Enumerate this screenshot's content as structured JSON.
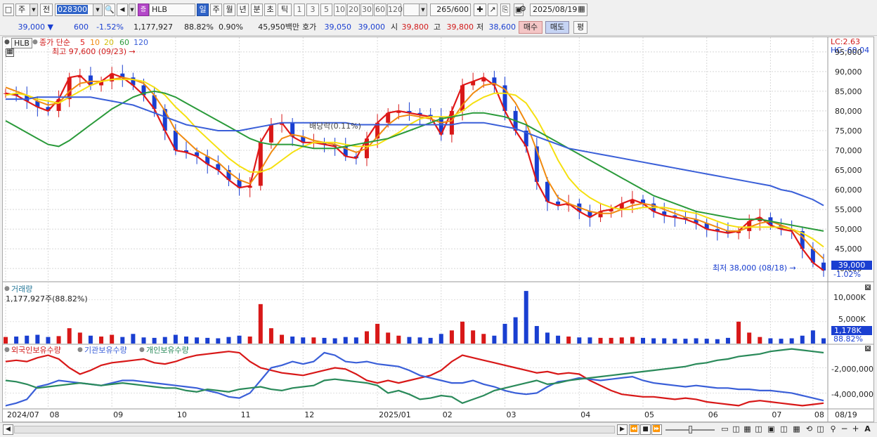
{
  "toolbar": {
    "period_main": "주",
    "prev_btn": "전",
    "code": "028300",
    "stock_name": "HLB",
    "periods": [
      "일",
      "주",
      "월",
      "년",
      "분",
      "초",
      "틱"
    ],
    "intervals": [
      "1",
      "3",
      "5",
      "10",
      "20",
      "30",
      "60",
      "120"
    ],
    "count": "265",
    "count_total": "/600",
    "date": "2025/08/19"
  },
  "quote": {
    "price": "39,000",
    "change": "600",
    "change_pct": "-1.52%",
    "volume": "1,177,927",
    "vol_ratio": "88.82%",
    "turnover": "0.90%",
    "amount": "45,950백만",
    "bid_label": "호가",
    "bid": "39,050",
    "ask": "39,000",
    "open_label": "시",
    "open": "39,800",
    "high_label": "고",
    "high": "39,800",
    "low_label": "저",
    "low": "38,600",
    "buy": "매수",
    "sell": "매도",
    "avg": "평"
  },
  "price_panel": {
    "tag": "HLB",
    "legend_title": "종가 단순",
    "ma_periods": [
      "5",
      "10",
      "20",
      "60",
      "120"
    ],
    "high_note": "최고 97,600 (09/23)",
    "low_note": "최저 38,000 (08/18)",
    "dividend_note": "배당락(0.11%)",
    "lc": "LC:2.63",
    "hc": "HC:-60.04",
    "y_ticks": [
      "95,000",
      "90,000",
      "85,000",
      "80,000",
      "75,000",
      "70,000",
      "65,000",
      "60,000",
      "55,000",
      "50,000",
      "45,000",
      "40,000"
    ],
    "cur_price": "39,000",
    "cur_pct": "-1.02%"
  },
  "volume_panel": {
    "title": "거래량",
    "value": "1,177,927주(88.82%)",
    "y_ticks": [
      "10,000K",
      "5,000K"
    ],
    "cur": "1,178K",
    "cur_pct": "88.82%"
  },
  "holding_panel": {
    "series": [
      "외국인보유수량",
      "기관보유수량",
      "개인보유수량"
    ],
    "y_ticks": [
      "-2,000,000",
      "-4,000,000"
    ]
  },
  "x_axis": [
    "2024/07",
    "08",
    "09",
    "10",
    "11",
    "12",
    "2025/01",
    "02",
    "03",
    "04",
    "05",
    "06",
    "07",
    "08"
  ],
  "x_axis_right": "08/19",
  "colors": {
    "ma5": "#e01818",
    "ma10": "#f08a10",
    "ma20": "#f5e010",
    "ma60": "#2a9a3a",
    "ma120": "#3a5fd8",
    "up": "#d81818",
    "down": "#1a3fd1",
    "foreign": "#d81818",
    "institution": "#3a5fd8",
    "individual": "#2a8a5a"
  },
  "chart_data": {
    "type": "candlestick",
    "y_range": [
      37000,
      98000
    ],
    "ma_series": [
      {
        "name": "5",
        "values": [
          84500,
          84000,
          82500,
          81000,
          80000,
          83000,
          88500,
          89000,
          86500,
          87500,
          89500,
          88500,
          86500,
          84000,
          80500,
          75000,
          70000,
          69500,
          68500,
          66500,
          65000,
          62500,
          60500,
          61000,
          72000,
          76500,
          77000,
          73500,
          72000,
          72000,
          71500,
          71000,
          68500,
          68000,
          73000,
          77000,
          79500,
          80000,
          79500,
          79000,
          78500,
          74000,
          80000,
          86500,
          87500,
          88500,
          86500,
          80000,
          75000,
          71000,
          62000,
          57000,
          56000,
          56500,
          54500,
          53000,
          54500,
          55000,
          56500,
          57500,
          56500,
          54500,
          53500,
          53000,
          52500,
          51500,
          50000,
          49500,
          49000,
          49500,
          52000,
          53000,
          51000,
          50000,
          49500,
          45000,
          41500,
          39500
        ]
      },
      {
        "name": "10",
        "values": [
          86000,
          85000,
          84000,
          82500,
          81500,
          82000,
          85000,
          87000,
          87500,
          87500,
          88000,
          88500,
          88000,
          87000,
          84000,
          80000,
          75000,
          72500,
          70000,
          68500,
          67000,
          64500,
          62500,
          61500,
          65000,
          69500,
          73000,
          74000,
          73500,
          72500,
          72000,
          71500,
          70500,
          69500,
          70500,
          73500,
          76500,
          78500,
          79000,
          78500,
          78000,
          77000,
          77500,
          81500,
          84500,
          86500,
          87000,
          85500,
          82000,
          77000,
          70000,
          62500,
          58000,
          56500,
          55500,
          54500,
          54000,
          54000,
          55000,
          56000,
          56500,
          56000,
          55000,
          54000,
          53000,
          52500,
          51500,
          50500,
          49500,
          49500,
          50500,
          51500,
          52000,
          51000,
          50000,
          48000,
          45000,
          42500
        ]
      },
      {
        "name": "20",
        "values": [
          84000,
          84500,
          84000,
          83000,
          82500,
          82000,
          83500,
          85000,
          86500,
          87500,
          88000,
          88000,
          88000,
          87500,
          86000,
          84000,
          81000,
          78500,
          75500,
          73000,
          70500,
          68000,
          66000,
          64500,
          64500,
          65500,
          67500,
          69500,
          71000,
          72000,
          72000,
          72000,
          71500,
          71000,
          71000,
          71500,
          73000,
          74500,
          76500,
          78000,
          78500,
          78500,
          78500,
          80000,
          82000,
          83500,
          84500,
          84500,
          84000,
          82000,
          78000,
          73000,
          67500,
          63000,
          60000,
          58000,
          56500,
          55500,
          55000,
          55000,
          55500,
          55500,
          55500,
          55000,
          54500,
          54000,
          53000,
          52000,
          51000,
          50500,
          50500,
          50500,
          50500,
          50500,
          50000,
          49000,
          47500,
          45500
        ]
      },
      {
        "name": "60",
        "values": [
          77500,
          76000,
          74500,
          73000,
          71500,
          71000,
          72500,
          74500,
          76500,
          78500,
          80500,
          82000,
          83500,
          84500,
          85000,
          84500,
          83500,
          82000,
          80500,
          79000,
          77500,
          76000,
          74500,
          73000,
          72000,
          71500,
          71500,
          71500,
          71000,
          70500,
          70500,
          70500,
          71000,
          71500,
          72000,
          72500,
          73000,
          74000,
          75000,
          76000,
          77000,
          78000,
          78500,
          79000,
          79500,
          79500,
          79000,
          78500,
          77500,
          76500,
          75000,
          73500,
          72000,
          70500,
          69000,
          67500,
          66000,
          64500,
          63000,
          61500,
          60000,
          58500,
          57500,
          56500,
          55500,
          54500,
          54000,
          53500,
          53000,
          52500,
          52500,
          52500,
          52000,
          51500,
          51000,
          50500,
          50000,
          49500
        ]
      },
      {
        "name": "120",
        "values": [
          83000,
          83000,
          83000,
          83500,
          83500,
          83500,
          83500,
          83500,
          83500,
          83000,
          82500,
          82000,
          81500,
          80500,
          79500,
          78500,
          77500,
          76500,
          76000,
          75500,
          75000,
          75000,
          75000,
          75500,
          76000,
          76500,
          77000,
          77000,
          77000,
          77000,
          77000,
          77000,
          77000,
          76500,
          76500,
          76500,
          76500,
          76500,
          76500,
          76500,
          76500,
          76500,
          76500,
          77000,
          77000,
          77000,
          76500,
          76000,
          75500,
          74500,
          73500,
          72500,
          71500,
          70500,
          70000,
          69500,
          69000,
          68500,
          68000,
          67500,
          67000,
          66500,
          66000,
          65500,
          65000,
          64500,
          64000,
          63500,
          63000,
          62500,
          62000,
          61500,
          61000,
          60000,
          59500,
          58500,
          57500,
          56000
        ]
      }
    ],
    "volume_series": {
      "name": "거래량",
      "values": [
        1500,
        1600,
        1800,
        2000,
        1500,
        1700,
        3500,
        2500,
        1800,
        1600,
        2000,
        1500,
        2200,
        1400,
        1300,
        1500,
        2000,
        1600,
        1400,
        1300,
        1200,
        1500,
        1800,
        1600,
        9000,
        3500,
        2000,
        1600,
        1400,
        1400,
        1300,
        1200,
        1500,
        1400,
        2800,
        4500,
        2500,
        1800,
        1500,
        1400,
        1300,
        2200,
        3000,
        5000,
        3000,
        2200,
        1800,
        4500,
        6000,
        12000,
        4000,
        2500,
        1800,
        1600,
        1400,
        1400,
        1300,
        1300,
        1400,
        1500,
        1300,
        1200,
        1200,
        1100,
        1100,
        1200,
        1100,
        1000,
        1300,
        5000,
        2500,
        1500,
        1200,
        1100,
        1200,
        1800,
        3000,
        1200
      ]
    },
    "holding_series": [
      {
        "name": "외국인보유수량",
        "values": [
          -1500000,
          -1400000,
          -1500000,
          -1200000,
          -1000000,
          -1300000,
          -2000000,
          -2500000,
          -2200000,
          -1800000,
          -1600000,
          -1500000,
          -1400000,
          -1300000,
          -1600000,
          -1700000,
          -1500000,
          -1200000,
          -1000000,
          -900000,
          -800000,
          -700000,
          -800000,
          -1500000,
          -2000000,
          -2200000,
          -2400000,
          -2500000,
          -2600000,
          -2400000,
          -2200000,
          -2000000,
          -2100000,
          -2500000,
          -3000000,
          -3200000,
          -3000000,
          -3200000,
          -3000000,
          -2800000,
          -2600000,
          -2200000,
          -1500000,
          -1000000,
          -1200000,
          -1400000,
          -1600000,
          -1800000,
          -2000000,
          -2200000,
          -2400000,
          -2300000,
          -2500000,
          -2400000,
          -2500000,
          -3000000,
          -3400000,
          -3800000,
          -4100000,
          -4200000,
          -4300000,
          -4300000,
          -4400000,
          -4500000,
          -4400000,
          -4500000,
          -4700000,
          -4800000,
          -4900000,
          -5000000,
          -4700000,
          -4600000,
          -4700000,
          -4800000,
          -4900000,
          -5000000,
          -4900000,
          -4800000
        ]
      },
      {
        "name": "기관보유수량",
        "values": [
          -5000000,
          -4800000,
          -4500000,
          -3500000,
          -3300000,
          -3000000,
          -3100000,
          -3200000,
          -3300000,
          -3400000,
          -3200000,
          -3000000,
          -3000000,
          -3100000,
          -3200000,
          -3300000,
          -3400000,
          -3500000,
          -3600000,
          -3800000,
          -4000000,
          -4300000,
          -4400000,
          -4000000,
          -3000000,
          -2000000,
          -1800000,
          -1500000,
          -1700000,
          -1500000,
          -800000,
          -1000000,
          -1500000,
          -1600000,
          -1500000,
          -1700000,
          -1800000,
          -1900000,
          -2200000,
          -2600000,
          -2800000,
          -3000000,
          -3200000,
          -3200000,
          -3000000,
          -3300000,
          -3500000,
          -3800000,
          -4000000,
          -4100000,
          -4000000,
          -3500000,
          -3100000,
          -3000000,
          -2800000,
          -2900000,
          -3000000,
          -2900000,
          -2800000,
          -2700000,
          -3000000,
          -3200000,
          -3300000,
          -3400000,
          -3500000,
          -3400000,
          -3500000,
          -3600000,
          -3600000,
          -3700000,
          -3700000,
          -3800000,
          -3800000,
          -3900000,
          -4000000,
          -4200000,
          -4400000,
          -4600000
        ]
      },
      {
        "name": "개인보유수량",
        "values": [
          -3000000,
          -3100000,
          -3300000,
          -3600000,
          -3500000,
          -3400000,
          -3300000,
          -3200000,
          -3300000,
          -3400000,
          -3300000,
          -3200000,
          -3300000,
          -3400000,
          -3500000,
          -3600000,
          -3600000,
          -3800000,
          -3900000,
          -3700000,
          -3800000,
          -3900000,
          -3700000,
          -3600000,
          -3500000,
          -3700000,
          -3800000,
          -3600000,
          -3500000,
          -3400000,
          -3000000,
          -2900000,
          -3000000,
          -3100000,
          -3200000,
          -3400000,
          -4000000,
          -3800000,
          -4100000,
          -4500000,
          -4400000,
          -4200000,
          -4300000,
          -4800000,
          -4500000,
          -4200000,
          -3800000,
          -3600000,
          -3400000,
          -3200000,
          -3000000,
          -3300000,
          -3200000,
          -3000000,
          -2900000,
          -2800000,
          -2700000,
          -2600000,
          -2500000,
          -2400000,
          -2300000,
          -2200000,
          -2100000,
          -2000000,
          -1900000,
          -1700000,
          -1600000,
          -1400000,
          -1300000,
          -1100000,
          -1000000,
          -900000,
          -700000,
          -600000,
          -500000,
          -600000,
          -700000,
          -800000
        ]
      }
    ]
  }
}
